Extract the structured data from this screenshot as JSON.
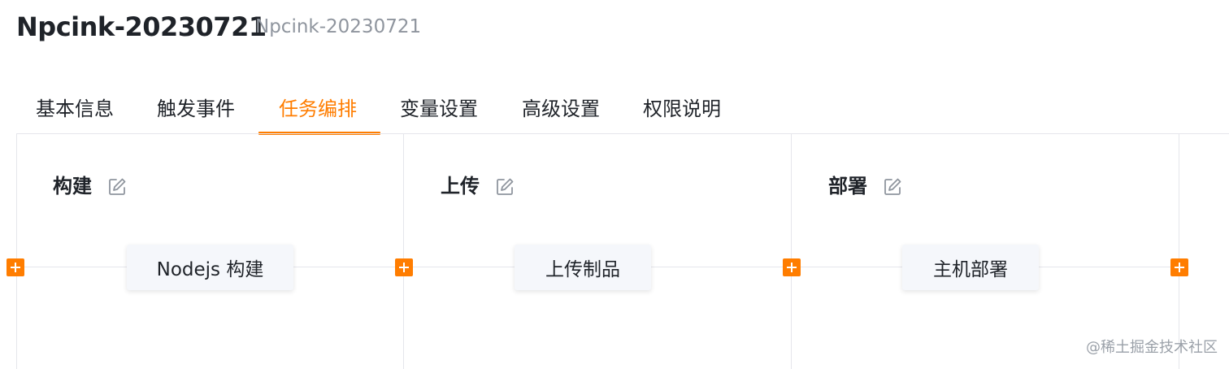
{
  "header": {
    "title": "Npcink-20230721",
    "subtitle": "Npcink-20230721"
  },
  "tabs": [
    {
      "label": "基本信息",
      "active": false
    },
    {
      "label": "触发事件",
      "active": false
    },
    {
      "label": "任务编排",
      "active": true
    },
    {
      "label": "变量设置",
      "active": false
    },
    {
      "label": "高级设置",
      "active": false
    },
    {
      "label": "权限说明",
      "active": false
    }
  ],
  "stages": [
    {
      "title": "构建",
      "edit_icon": "edit-icon",
      "job": "Nodejs 构建"
    },
    {
      "title": "上传",
      "edit_icon": "edit-icon",
      "job": "上传制品"
    },
    {
      "title": "部署",
      "edit_icon": "edit-icon",
      "job": "主机部署"
    }
  ],
  "add_button_icon": "plus-icon",
  "watermark": "@稀土掘金技术社区",
  "colors": {
    "accent": "#ff7d00",
    "text": "#1f2329",
    "muted": "#8f959e",
    "border": "#e5e6eb",
    "card_bg": "#f5f7fb"
  }
}
